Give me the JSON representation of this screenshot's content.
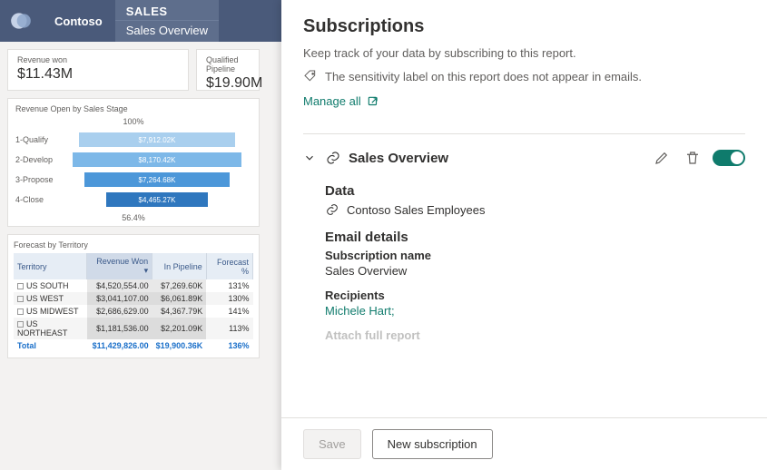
{
  "header": {
    "brand": "Contoso",
    "section": "SALES",
    "page": "Sales Overview"
  },
  "cards": {
    "revenueWon": {
      "title": "Revenue won",
      "value": "$11.43M"
    },
    "pipeline": {
      "title": "Qualified Pipeline",
      "value": "$19.90M"
    }
  },
  "chart_data": {
    "type": "bar",
    "title": "Revenue Open by Sales Stage",
    "xlabel": "",
    "ylabel": "",
    "top_pct": "100%",
    "bottom_pct": "56.4%",
    "categories": [
      "1-Qualify",
      "2-Develop",
      "3-Propose",
      "4-Close"
    ],
    "series": [
      {
        "name": "Revenue Open",
        "values": [
          7912.02,
          8170.42,
          7264.68,
          4465.27
        ],
        "value_labels": [
          "$7,912.02K",
          "$8,170.42K",
          "$7,264.68K",
          "$4,465.27K"
        ],
        "colors": [
          "#a9cfee",
          "#7db8e8",
          "#4c97d9",
          "#2f77be"
        ],
        "widths_pct": [
          86,
          93,
          80,
          56
        ]
      }
    ]
  },
  "table": {
    "title": "Forecast by Territory",
    "headers": [
      "Territory",
      "Revenue Won",
      "In Pipeline",
      "Forecast %"
    ],
    "rows": [
      {
        "territory": "US SOUTH",
        "won": "$4,520,554.00",
        "pipe": "$7,269.60K",
        "fc": "131%"
      },
      {
        "territory": "US WEST",
        "won": "$3,041,107.00",
        "pipe": "$6,061.89K",
        "fc": "130%"
      },
      {
        "territory": "US MIDWEST",
        "won": "$2,686,629.00",
        "pipe": "$4,367.79K",
        "fc": "141%"
      },
      {
        "territory": "US NORTHEAST",
        "won": "$1,181,536.00",
        "pipe": "$2,201.09K",
        "fc": "113%"
      }
    ],
    "total": {
      "label": "Total",
      "won": "$11,429,826.00",
      "pipe": "$19,900.36K",
      "fc": "136%"
    }
  },
  "panel": {
    "title": "Subscriptions",
    "subtitle": "Keep track of your data by subscribing to this report.",
    "sensitivity": "The sensitivity label on this report does not appear in emails.",
    "manage": "Manage all",
    "subscription": {
      "title": "Sales Overview",
      "data_label": "Data",
      "data_value": "Contoso Sales Employees",
      "email_label": "Email details",
      "name_label": "Subscription name",
      "name_value": "Sales Overview",
      "recip_label": "Recipients",
      "recip_value": "Michele Hart;",
      "cutoff": "Attach full report"
    },
    "buttons": {
      "save": "Save",
      "new": "New subscription"
    }
  }
}
